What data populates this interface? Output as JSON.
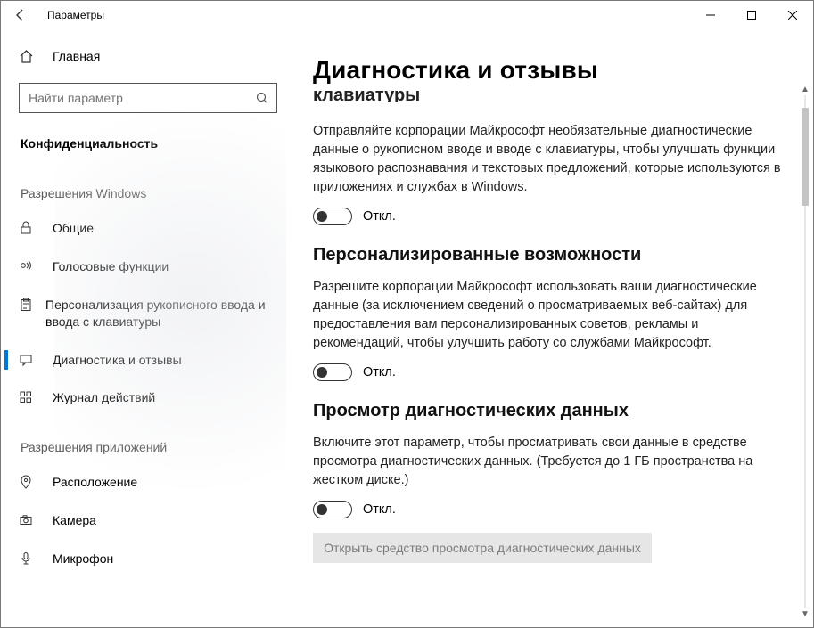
{
  "window": {
    "title": "Параметры"
  },
  "home": {
    "label": "Главная"
  },
  "search": {
    "placeholder": "Найти параметр"
  },
  "category": "Конфиденциальность",
  "group1": "Разрешения Windows",
  "group2": "Разрешения приложений",
  "nav": {
    "general": "Общие",
    "speech": "Голосовые функции",
    "inking": "Персонализация рукописного ввода и ввода с клавиатуры",
    "diagnostics": "Диагностика и отзывы",
    "activity": "Журнал действий",
    "location": "Расположение",
    "camera": "Камера",
    "microphone": "Микрофон"
  },
  "page": {
    "title": "Диагностика и отзывы",
    "truncated_heading": "клавиатуры",
    "sec1_desc": "Отправляйте корпорации Майкрософт необязательные диагностические данные о рукописном вводе и вводе с клавиатуры, чтобы улучшать функции языкового распознавания и текстовых предложений, которые используются в приложениях и службах в Windows.",
    "toggle_off": "Откл.",
    "sec2_title": "Персонализированные возможности",
    "sec2_desc": "Разрешите корпорации Майкрософт использовать ваши диагностические данные (за исключением сведений о просматриваемых веб-сайтах) для предоставления вам персонализированных советов, рекламы и рекомендаций, чтобы улучшить работу со службами Майкрософт.",
    "sec3_title": "Просмотр диагностических данных",
    "sec3_desc": "Включите этот параметр, чтобы просматривать свои данные в средстве просмотра диагностических данных. (Требуется до 1 ГБ пространства на жестком диске.)",
    "viewer_btn": "Открыть средство просмотра диагностических данных"
  }
}
